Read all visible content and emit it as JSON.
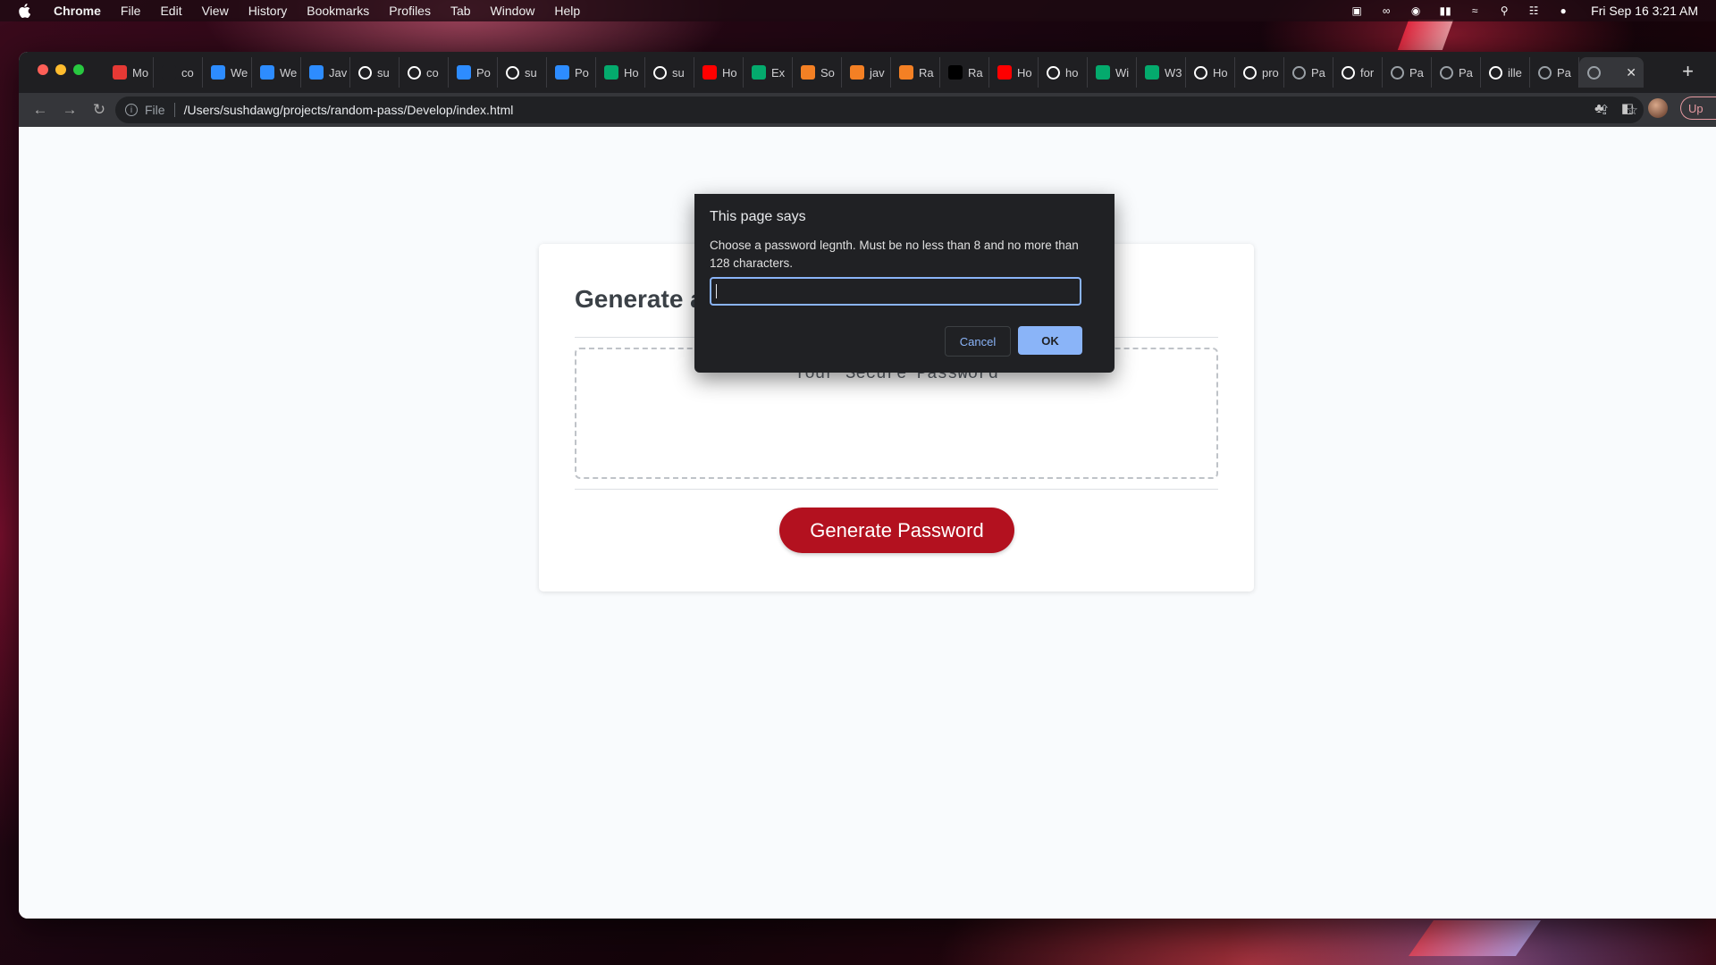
{
  "menubar": {
    "app_name": "Chrome",
    "items": [
      "File",
      "Edit",
      "View",
      "History",
      "Bookmarks",
      "Profiles",
      "Tab",
      "Window",
      "Help"
    ],
    "clock": "Fri Sep 16  3:21 AM"
  },
  "tabs": [
    {
      "label": "Mo",
      "icon": "youtube-red-icon",
      "color": "#e53935"
    },
    {
      "label": "co",
      "icon": "blank-icon",
      "color": "#1f1f22"
    },
    {
      "label": "We",
      "icon": "zoom-icon",
      "color": "#2d8cff"
    },
    {
      "label": "We",
      "icon": "zoom-icon",
      "color": "#2d8cff"
    },
    {
      "label": "Jav",
      "icon": "zoom-icon",
      "color": "#2d8cff"
    },
    {
      "label": "su",
      "icon": "github-icon",
      "color": "#ffffff"
    },
    {
      "label": "co",
      "icon": "github-icon",
      "color": "#ffffff"
    },
    {
      "label": "Po",
      "icon": "zoom-icon",
      "color": "#2d8cff"
    },
    {
      "label": "su",
      "icon": "github-icon",
      "color": "#ffffff"
    },
    {
      "label": "Po",
      "icon": "zoom-icon",
      "color": "#2d8cff"
    },
    {
      "label": "Ho",
      "icon": "w3-icon",
      "color": "#04aa6d"
    },
    {
      "label": "su",
      "icon": "github-icon",
      "color": "#ffffff"
    },
    {
      "label": "Ho",
      "icon": "youtube-icon",
      "color": "#ff0000"
    },
    {
      "label": "Ex",
      "icon": "w3-icon",
      "color": "#04aa6d"
    },
    {
      "label": "So",
      "icon": "shield-icon",
      "color": "#f48024"
    },
    {
      "label": "jav",
      "icon": "stackoverflow-icon",
      "color": "#f48024"
    },
    {
      "label": "Ra",
      "icon": "stackoverflow-icon",
      "color": "#f48024"
    },
    {
      "label": "Ra",
      "icon": "dev-icon",
      "color": "#000000"
    },
    {
      "label": "Ho",
      "icon": "youtube-icon",
      "color": "#ff0000"
    },
    {
      "label": "ho",
      "icon": "google-icon",
      "color": "#ffffff"
    },
    {
      "label": "Wi",
      "icon": "w3-icon",
      "color": "#04aa6d"
    },
    {
      "label": "W3",
      "icon": "w3-icon",
      "color": "#04aa6d"
    },
    {
      "label": "Ho",
      "icon": "github-icon",
      "color": "#ffffff"
    },
    {
      "label": "pro",
      "icon": "google-icon",
      "color": "#ffffff"
    },
    {
      "label": "Pa",
      "icon": "globe-icon",
      "color": "#9aa0a6"
    },
    {
      "label": "for",
      "icon": "google-icon",
      "color": "#ffffff"
    },
    {
      "label": "Pa",
      "icon": "globe-icon",
      "color": "#9aa0a6"
    },
    {
      "label": "Pa",
      "icon": "globe-icon",
      "color": "#9aa0a6"
    },
    {
      "label": "ille",
      "icon": "google-icon",
      "color": "#ffffff"
    },
    {
      "label": "Pa",
      "icon": "globe-icon",
      "color": "#9aa0a6"
    }
  ],
  "toolbar": {
    "scheme": "File",
    "url": "/Users/sushdawg/projects/random-pass/Develop/index.html",
    "update_label": "Up"
  },
  "page": {
    "heading": "Generate a Password",
    "password_placeholder": "Your Secure Password",
    "generate_label": "Generate Password",
    "accent_color": "#b3111f"
  },
  "dialog": {
    "title": "This page says",
    "message": "Choose a password legnth. Must be no less than 8 and no more than 128 characters.",
    "input_value": "",
    "cancel_label": "Cancel",
    "ok_label": "OK"
  }
}
